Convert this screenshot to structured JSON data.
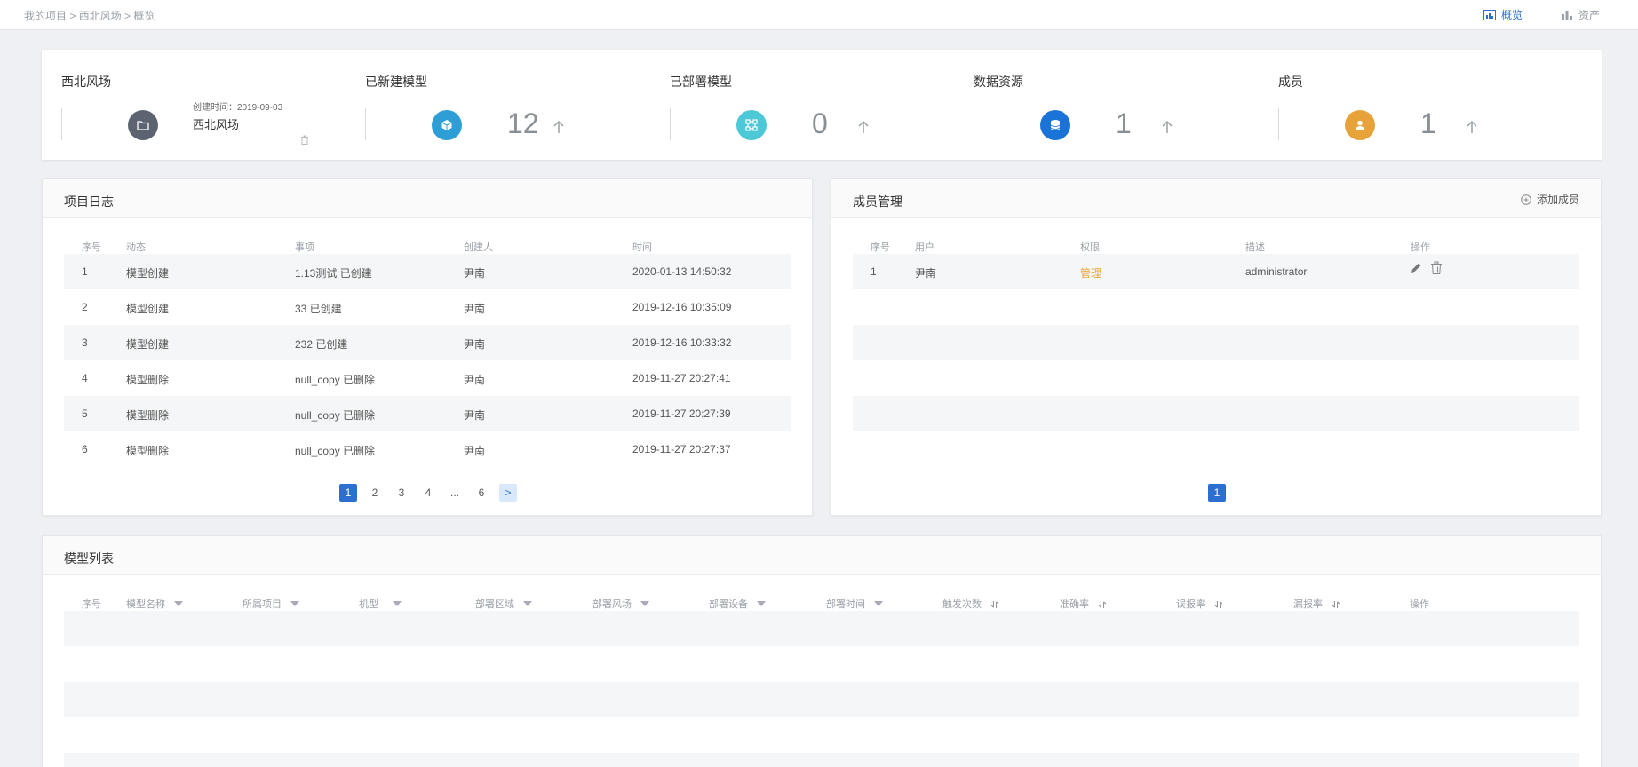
{
  "breadcrumb": "我的项目 > 西北风场 > 概览",
  "topnav": {
    "overview": "概览",
    "assets": "资产"
  },
  "summary": {
    "project": {
      "title": "西北风场",
      "created": "创建时间：2019-09-03",
      "name": "西北风场"
    },
    "stats": [
      {
        "title": "已新建模型",
        "value": "12",
        "color": "#2e9fd6",
        "icon": "cube-icon"
      },
      {
        "title": "已部署模型",
        "value": "0",
        "color": "#4dc8d6",
        "icon": "network-icon"
      },
      {
        "title": "数据资源",
        "value": "1",
        "color": "#1a73d6",
        "icon": "database-icon"
      },
      {
        "title": "成员",
        "value": "1",
        "color": "#e8a23a",
        "icon": "user-icon"
      }
    ],
    "project_icon_color": "#5b6470"
  },
  "log": {
    "title": "项目日志",
    "headers": [
      "序号",
      "动态",
      "事项",
      "创建人",
      "时间"
    ],
    "rows": [
      [
        "1",
        "模型创建",
        "1.13测试 已创建",
        "尹南",
        "2020-01-13 14:50:32"
      ],
      [
        "2",
        "模型创建",
        "33 已创建",
        "尹南",
        "2019-12-16 10:35:09"
      ],
      [
        "3",
        "模型创建",
        "232 已创建",
        "尹南",
        "2019-12-16 10:33:32"
      ],
      [
        "4",
        "模型删除",
        "null_copy 已删除",
        "尹南",
        "2019-11-27 20:27:41"
      ],
      [
        "5",
        "模型删除",
        "null_copy 已删除",
        "尹南",
        "2019-11-27 20:27:39"
      ],
      [
        "6",
        "模型删除",
        "null_copy 已删除",
        "尹南",
        "2019-11-27 20:27:37"
      ]
    ],
    "pages": [
      "1",
      "2",
      "3",
      "4",
      "...",
      "6",
      ">"
    ]
  },
  "members": {
    "title": "成员管理",
    "add_label": "添加成员",
    "headers": [
      "序号",
      "用户",
      "权限",
      "描述",
      "操作"
    ],
    "rows": [
      [
        "1",
        "尹南",
        "管理",
        "administrator"
      ]
    ],
    "pages": [
      "1"
    ]
  },
  "models": {
    "title": "模型列表",
    "headers": [
      "序号",
      "模型名称",
      "所属项目",
      "机型",
      "部署区域",
      "部署风场",
      "部署设备",
      "部署时间",
      "触发次数",
      "准确率",
      "误报率",
      "漏报率",
      "操作"
    ]
  },
  "colors": {
    "accent": "#2d6fd1",
    "role": "#e8a23a"
  }
}
